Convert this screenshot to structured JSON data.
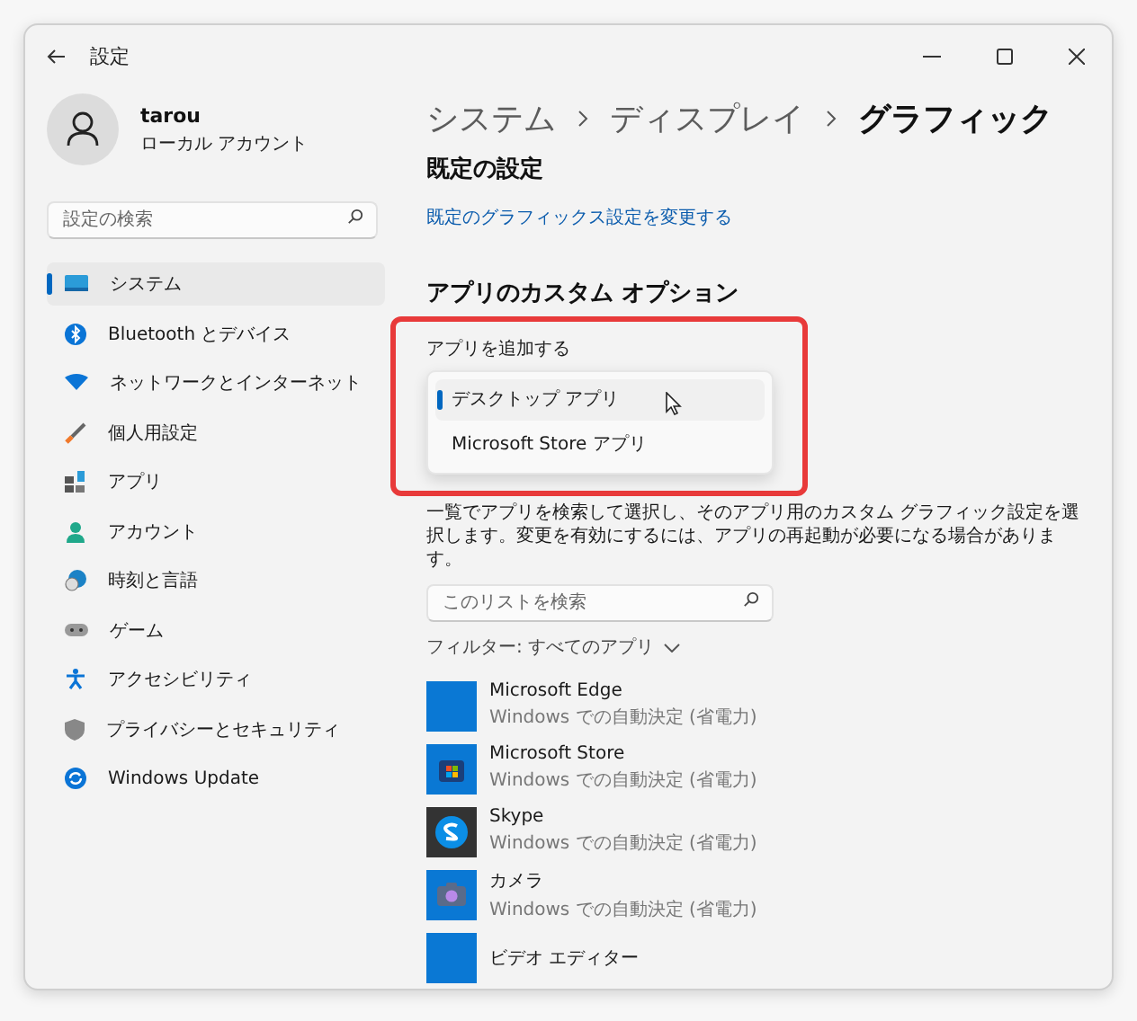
{
  "window": {
    "title": "設定"
  },
  "account": {
    "name": "tarou",
    "type": "ローカル アカウント"
  },
  "sidebar": {
    "search": {
      "placeholder": "設定の検索"
    },
    "items": [
      {
        "label": "システム",
        "selected": true
      },
      {
        "label": "Bluetooth とデバイス",
        "selected": false
      },
      {
        "label": "ネットワークとインターネット",
        "selected": false
      },
      {
        "label": "個人用設定",
        "selected": false
      },
      {
        "label": "アプリ",
        "selected": false
      },
      {
        "label": "アカウント",
        "selected": false
      },
      {
        "label": "時刻と言語",
        "selected": false
      },
      {
        "label": "ゲーム",
        "selected": false
      },
      {
        "label": "アクセシビリティ",
        "selected": false
      },
      {
        "label": "プライバシーとセキュリティ",
        "selected": false
      },
      {
        "label": "Windows Update",
        "selected": false
      }
    ]
  },
  "breadcrumb": [
    "システム",
    "ディスプレイ",
    "グラフィック"
  ],
  "default_settings": {
    "heading": "既定の設定",
    "link": "既定のグラフィックス設定を変更する"
  },
  "custom_options": {
    "heading": "アプリのカスタム オプション",
    "add_app_label": "アプリを追加する",
    "menu": [
      {
        "label": "デスクトップ アプリ",
        "selected": true
      },
      {
        "label": "Microsoft Store アプリ",
        "selected": false
      }
    ],
    "description": "一覧でアプリを検索して選択し、そのアプリ用のカスタム グラフィック設定を選択します。変更を有効にするには、アプリの再起動が必要になる場合があります。",
    "search": {
      "placeholder": "このリストを検索"
    },
    "filter": "フィルター: すべてのアプリ",
    "apps": [
      {
        "name": "Microsoft Edge",
        "setting": "Windows での自動決定 (省電力)"
      },
      {
        "name": "Microsoft Store",
        "setting": "Windows での自動決定 (省電力)"
      },
      {
        "name": "Skype",
        "setting": "Windows での自動決定 (省電力)"
      },
      {
        "name": "カメラ",
        "setting": "Windows での自動決定 (省電力)"
      },
      {
        "name": "ビデオ エディター"
      }
    ]
  }
}
